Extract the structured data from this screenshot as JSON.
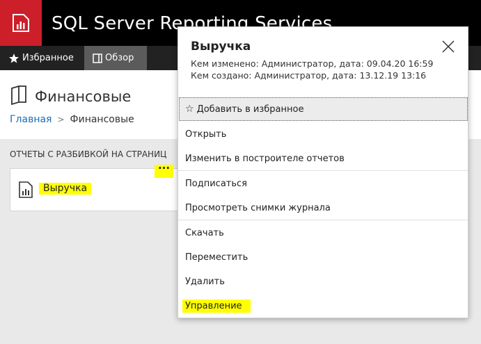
{
  "header": {
    "app_title": "SQL Server Reporting Services",
    "logo_icon": "report-logo-icon"
  },
  "nav": {
    "favorites_label": "Избранное",
    "browse_label": "Обзор"
  },
  "page": {
    "folder_title": "Финансовые",
    "breadcrumb": {
      "home": "Главная",
      "current": "Финансовые"
    },
    "section_title": "ОТЧЕТЫ С РАЗБИВКОЙ НА СТРАНИЦ",
    "report": {
      "name": "Выручка",
      "ellipsis": "···"
    }
  },
  "popup": {
    "title": "Выручка",
    "modified": "Кем изменено: Администратор, дата: 09.04.20 16:59",
    "created": "Кем создано: Администратор, дата: 13.12.19 13:16",
    "menu": {
      "add_favorite": "Добавить в избранное",
      "open": "Открыть",
      "edit_builder": "Изменить в построителе отчетов",
      "subscribe": "Подписаться",
      "history": "Просмотреть снимки журнала",
      "download": "Скачать",
      "move": "Переместить",
      "delete": "Удалить",
      "manage": "Управление"
    }
  },
  "colors": {
    "brand_red": "#cc1f2a",
    "link_blue": "#1a6cb8",
    "highlight": "#ffff00"
  }
}
